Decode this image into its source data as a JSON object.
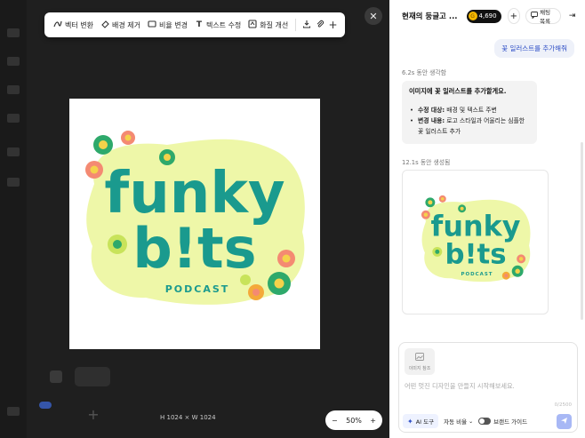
{
  "toolbar": {
    "vectorize": "벡터 변환",
    "remove_bg": "배경 제거",
    "change_ratio": "비율 변경",
    "edit_text": "텍스트 수정",
    "improve_quality": "화질 개선",
    "icons": {
      "vectorize": "wave-icon",
      "remove_bg": "eraser-icon",
      "change_ratio": "ratio-icon",
      "edit_text": "text-icon",
      "improve_quality": "enhance-icon",
      "download": "download-icon",
      "attach": "paperclip-icon",
      "add": "plus-icon"
    }
  },
  "canvas": {
    "dimensions": "H 1024  ×  W 1024",
    "zoom": "50%",
    "logo": {
      "line1": "funky",
      "line2": "b!ts",
      "tagline": "PODCAST"
    }
  },
  "panel": {
    "title": "현재의 둥글고 ...",
    "credits": "4,690",
    "chat_list": "채팅 목록",
    "user_message": "꽃 일러스트를 추가해줘",
    "thinking_label": "6.2s 동안 생각함",
    "reply": {
      "title": "이미지에 꽃 일러스트를 추가할게요.",
      "items": [
        {
          "key": "수정 대상:",
          "value": " 배경 및 텍스트 주변"
        },
        {
          "key": "변경 내용:",
          "value": " 로고 스타일과 어울리는 심플한 꽃 일러스트 추가"
        }
      ]
    },
    "generated_label": "12.1s 동안 생성됨"
  },
  "composer": {
    "image_ref": "이미지 참조",
    "placeholder": "어떤 멋진 디자인을 만들지 시작해보세요.",
    "counter": "0/2500",
    "ai_tools": "AI 도구",
    "ratio": "자동 비율",
    "brand_guide": "브랜드 가이드"
  },
  "colors": {
    "logo_teal": "#1a9a8e",
    "blob_lime": "#eef7a8",
    "accent_blue": "#2f4fc6"
  }
}
